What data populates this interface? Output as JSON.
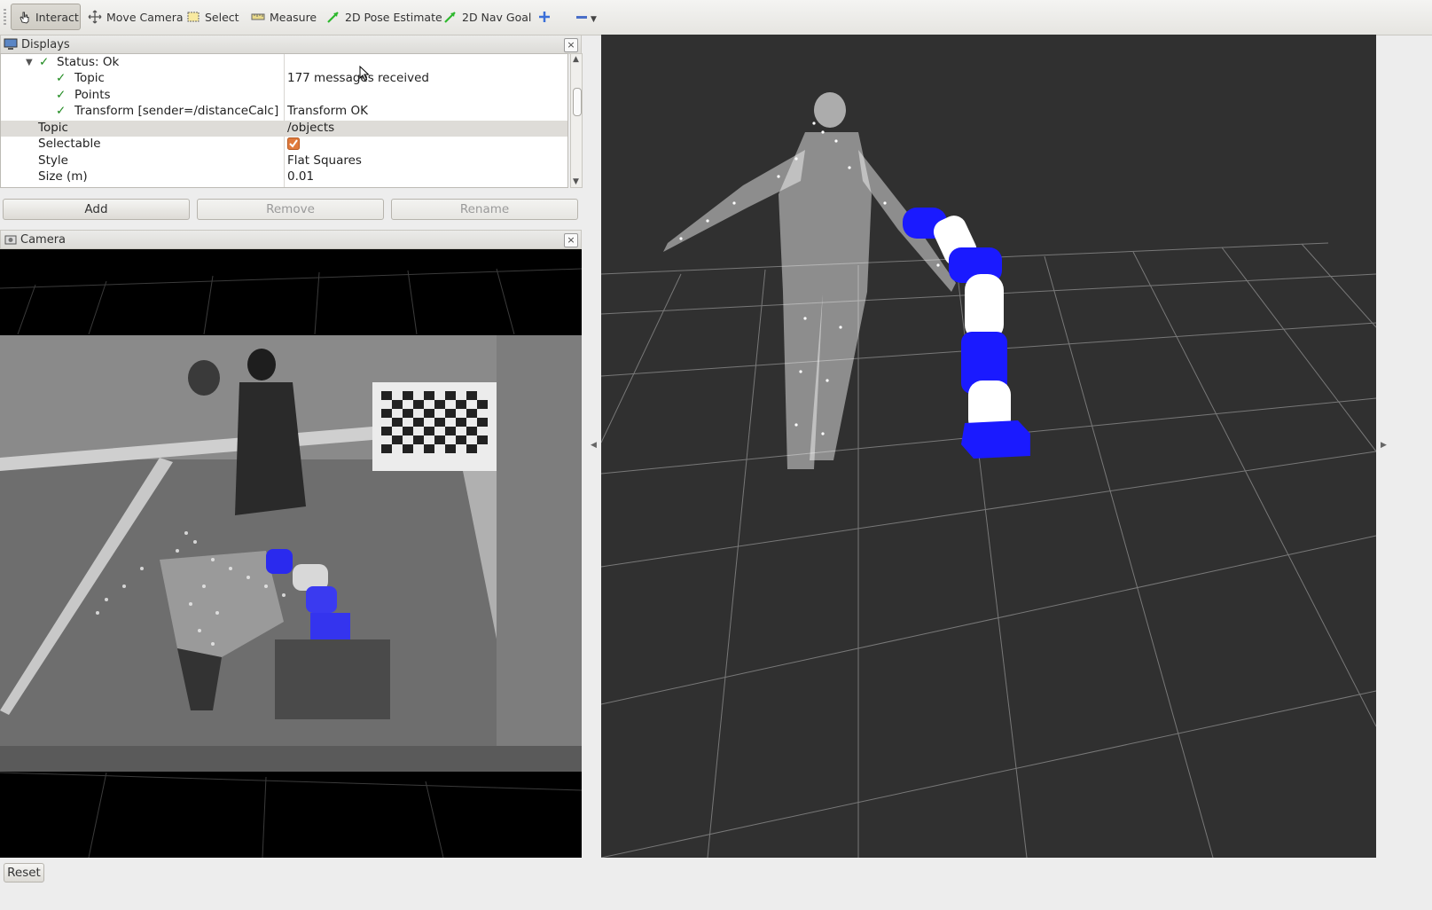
{
  "toolbar": {
    "tools": [
      {
        "label": "Interact",
        "icon": "hand-icon"
      },
      {
        "label": "Move Camera",
        "icon": "move-camera-icon"
      },
      {
        "label": "Select",
        "icon": "select-box-icon"
      },
      {
        "label": "Measure",
        "icon": "ruler-icon"
      },
      {
        "label": "2D Pose Estimate",
        "icon": "green-arrow-icon"
      },
      {
        "label": "2D Nav Goal",
        "icon": "green-arrow-icon"
      }
    ],
    "active_tool": "Interact"
  },
  "displays_panel": {
    "title": "Displays",
    "rows": [
      {
        "name": "Status: Ok",
        "value": ""
      },
      {
        "name": "Topic",
        "value": "177 messages received"
      },
      {
        "name": "Points",
        "value": ""
      },
      {
        "name": "Transform [sender=/distanceCalc]",
        "value": "Transform OK"
      },
      {
        "name": "Topic",
        "value": "/objects"
      },
      {
        "name": "Selectable",
        "value": ""
      },
      {
        "name": "Style",
        "value": "Flat Squares"
      },
      {
        "name": "Size (m)",
        "value": "0.01"
      }
    ],
    "selectable_checked": true,
    "buttons": {
      "add": "Add",
      "remove": "Remove",
      "rename": "Rename"
    }
  },
  "camera_panel": {
    "title": "Camera"
  },
  "statusbar": {
    "reset": "Reset"
  },
  "colors": {
    "view_background": "#303030",
    "robot_blue": "#1a1aff",
    "robot_white": "#ffffff",
    "check_green": "#1f8a1f",
    "checkbox_orange": "#e07a3c"
  }
}
